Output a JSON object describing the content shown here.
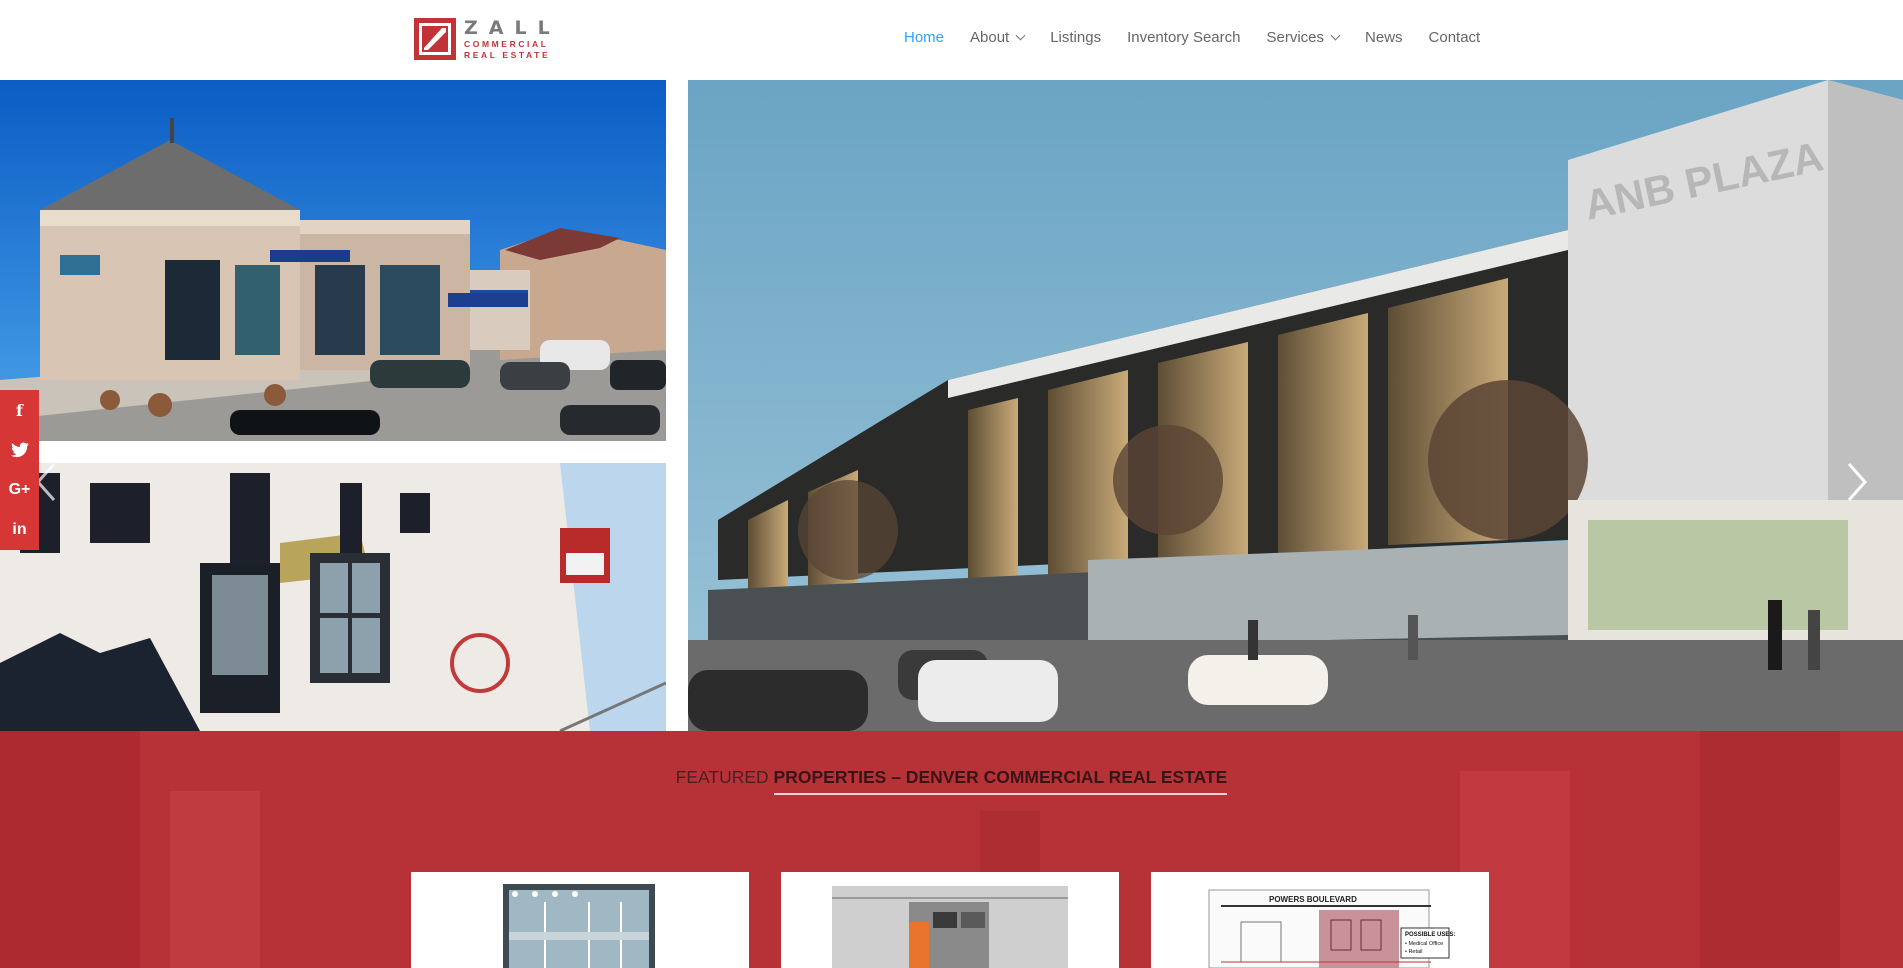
{
  "brand": {
    "name": "ZALL",
    "line1": "COMMERCIAL",
    "line2": "REAL ESTATE",
    "accent": "#c23338"
  },
  "nav": {
    "items": [
      {
        "label": "Home",
        "active": true,
        "has_dropdown": false
      },
      {
        "label": "About",
        "active": false,
        "has_dropdown": true
      },
      {
        "label": "Listings",
        "active": false,
        "has_dropdown": false
      },
      {
        "label": "Inventory Search",
        "active": false,
        "has_dropdown": false
      },
      {
        "label": "Services",
        "active": false,
        "has_dropdown": true
      },
      {
        "label": "News",
        "active": false,
        "has_dropdown": false
      },
      {
        "label": "Contact",
        "active": false,
        "has_dropdown": false
      }
    ],
    "active_color": "#2ea3f2"
  },
  "hero": {
    "building_sign": "ANB PLAZA",
    "prev_icon": "chevron-left-icon",
    "next_icon": "chevron-right-icon"
  },
  "social": {
    "buttons": [
      {
        "icon": "facebook-icon",
        "glyph": "f"
      },
      {
        "icon": "twitter-icon",
        "glyph": "🐦"
      },
      {
        "icon": "google-plus-icon",
        "glyph": "G+"
      },
      {
        "icon": "linkedin-icon",
        "glyph": "in"
      }
    ],
    "color": "#d63636"
  },
  "featured": {
    "title_lead": "FEATURED ",
    "title_bold": "PROPERTIES – DENVER COMMERCIAL REAL ESTATE",
    "band_color": "#b73237",
    "card3_labels": [
      "POWERS BOULEVARD",
      "POSSIBLE USES:",
      "• Medical Office",
      "• Retail"
    ]
  }
}
